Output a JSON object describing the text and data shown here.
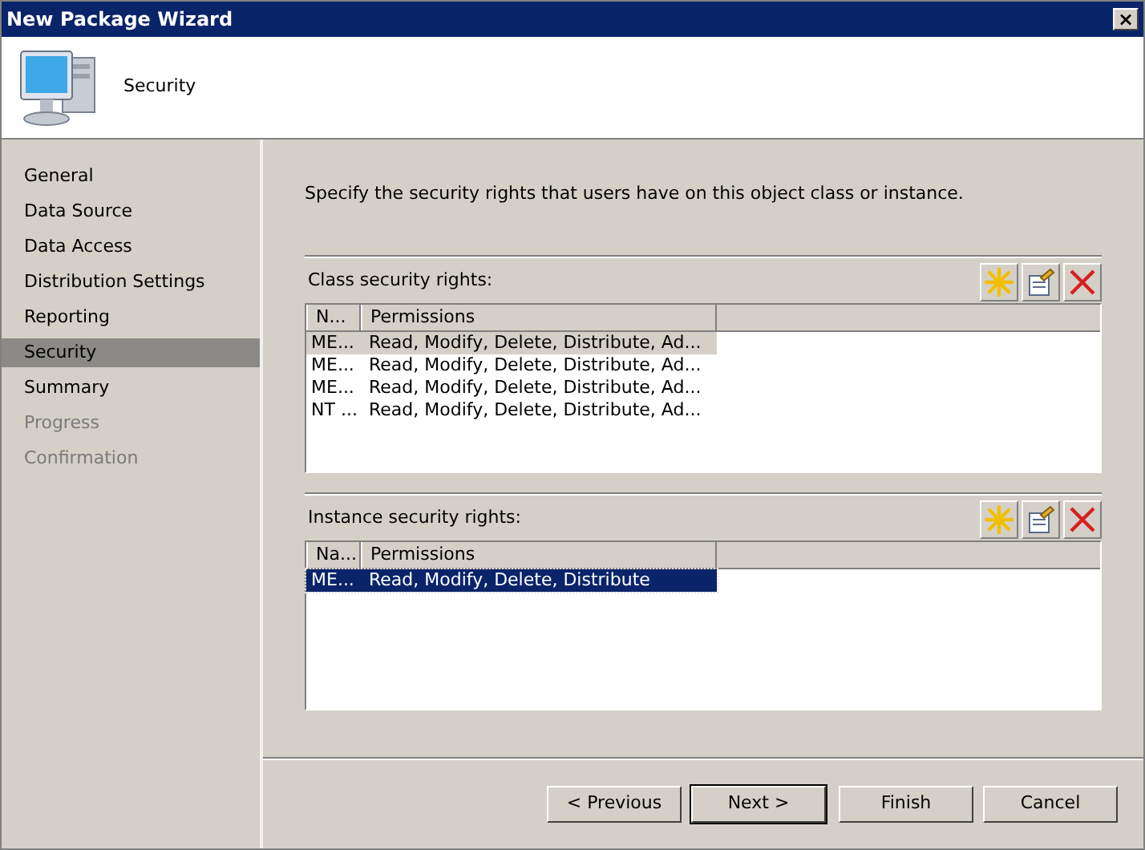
{
  "window": {
    "title": "New Package Wizard",
    "close": "×"
  },
  "header": {
    "title": "Security"
  },
  "sidebar": {
    "items": [
      {
        "label": "General",
        "selected": false,
        "disabled": false
      },
      {
        "label": "Data Source",
        "selected": false,
        "disabled": false
      },
      {
        "label": "Data Access",
        "selected": false,
        "disabled": false
      },
      {
        "label": "Distribution Settings",
        "selected": false,
        "disabled": false
      },
      {
        "label": "Reporting",
        "selected": false,
        "disabled": false
      },
      {
        "label": "Security",
        "selected": true,
        "disabled": false
      },
      {
        "label": "Summary",
        "selected": false,
        "disabled": false
      },
      {
        "label": "Progress",
        "selected": false,
        "disabled": true
      },
      {
        "label": "Confirmation",
        "selected": false,
        "disabled": true
      }
    ]
  },
  "intro": "Specify the security rights that users have on this object class or instance.",
  "sections": [
    {
      "label": "Class security rights:",
      "focused": false,
      "columns": [
        "N...",
        "Permissions"
      ],
      "rows": [
        {
          "cells": [
            "ME...",
            "Read, Modify, Delete, Distribute, Ad..."
          ],
          "selected": true
        },
        {
          "cells": [
            "ME...",
            "Read, Modify, Delete, Distribute, Ad..."
          ],
          "selected": false
        },
        {
          "cells": [
            "ME...",
            "Read, Modify, Delete, Distribute, Ad..."
          ],
          "selected": false
        },
        {
          "cells": [
            "NT ...",
            "Read, Modify, Delete, Distribute, Ad..."
          ],
          "selected": false
        }
      ]
    },
    {
      "label": "Instance security rights:",
      "focused": true,
      "columns": [
        "Na...",
        "Permissions"
      ],
      "rows": [
        {
          "cells": [
            "ME...",
            "Read, Modify, Delete, Distribute"
          ],
          "selected": true
        }
      ]
    }
  ],
  "buttons": [
    {
      "label": "< Previous",
      "default": false
    },
    {
      "label": "Next >",
      "default": true
    },
    {
      "label": "Finish",
      "default": false
    },
    {
      "label": "Cancel",
      "default": false
    }
  ]
}
